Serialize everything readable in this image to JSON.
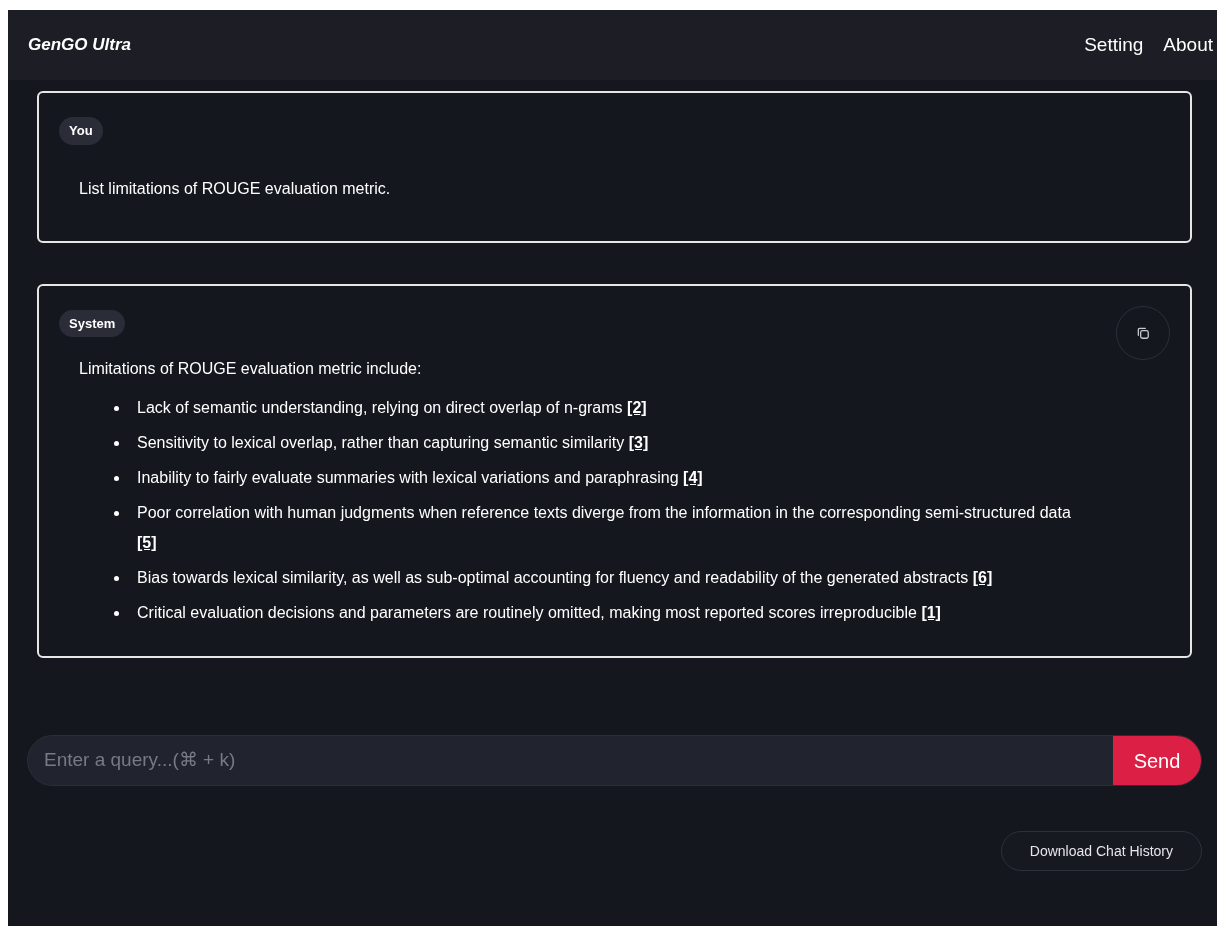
{
  "header": {
    "title": "GenGO Ultra",
    "nav": [
      "Setting",
      "About"
    ]
  },
  "messages": [
    {
      "role": "You",
      "kind": "user",
      "text": "List limitations of ROUGE evaluation metric."
    },
    {
      "role": "System",
      "kind": "system",
      "text": "Limitations of ROUGE evaluation metric include:",
      "items": [
        {
          "text": "Lack of semantic understanding, relying on direct overlap of n-grams",
          "citation": "[2]"
        },
        {
          "text": "Sensitivity to lexical overlap, rather than capturing semantic similarity",
          "citation": "[3]"
        },
        {
          "text": "Inability to fairly evaluate summaries with lexical variations and paraphrasing",
          "citation": "[4]"
        },
        {
          "text": "Poor correlation with human judgments when reference texts diverge from the information in the corresponding semi-structured data",
          "citation": "[5]"
        },
        {
          "text": "Bias towards lexical similarity, as well as sub-optimal accounting for fluency and readability of the generated abstracts",
          "citation": "[6]"
        },
        {
          "text": "Critical evaluation decisions and parameters are routinely omitted, making most reported scores irreproducible",
          "citation": "[1]"
        }
      ]
    }
  ],
  "query": {
    "placeholder": "Enter a query...(⌘ + k)",
    "button": "Send"
  },
  "download_button": "Download Chat History"
}
